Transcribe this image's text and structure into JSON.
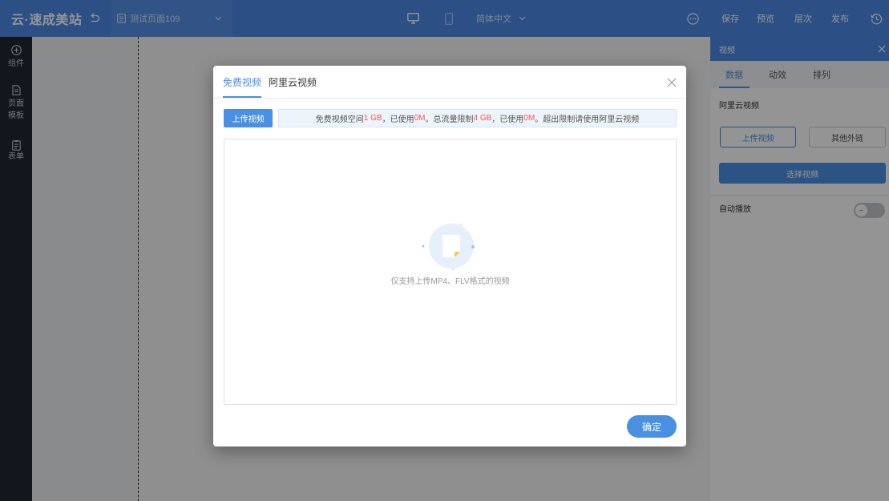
{
  "app": {
    "logo": "云·速成美站",
    "page_name": "测试页面109",
    "language": "简体中文",
    "desktop_view_active": true,
    "mobile_view_active": false,
    "actions": {
      "save": "保存",
      "preview": "预览",
      "layers": "层次",
      "publish": "发布"
    }
  },
  "sidebar": {
    "items": [
      {
        "label": "组件",
        "icon": "plus-circle-icon"
      },
      {
        "label": "页面模板",
        "icon": "page-template-icon"
      },
      {
        "label": "表单",
        "icon": "form-icon"
      }
    ]
  },
  "properties_panel": {
    "title": "视频",
    "tabs": [
      {
        "label": "数据",
        "active": true
      },
      {
        "label": "动效",
        "active": false
      },
      {
        "label": "排列",
        "active": false
      }
    ],
    "section_title": "阿里云视频",
    "upload_button": "上传视频",
    "external_link_button": "其他外链",
    "select_video_button": "选择视频",
    "autoplay_label": "自动播放",
    "autoplay_enabled": false
  },
  "video_modal": {
    "tabs": [
      {
        "label": "免费视频",
        "active": true
      },
      {
        "label": "阿里云视频",
        "active": false
      }
    ],
    "upload_button": "上传视频",
    "quota_segments": [
      {
        "text": "免费视频空间",
        "highlight": false
      },
      {
        "text": "1 GB",
        "highlight": true
      },
      {
        "text": "，已使用",
        "highlight": false
      },
      {
        "text": "0M",
        "highlight": true
      },
      {
        "text": "。总流量限制",
        "highlight": false
      },
      {
        "text": "4 GB",
        "highlight": true
      },
      {
        "text": "，已使用",
        "highlight": false
      },
      {
        "text": "0M",
        "highlight": true
      },
      {
        "text": "。超出限制请使用阿里云视频",
        "highlight": false
      }
    ],
    "empty_hint": "仅支持上传MP4、FLV格式的视频",
    "confirm_button": "确定"
  },
  "colors": {
    "topbar": "#4d8ae6",
    "accent": "#4a90e2",
    "quota_highlight": "#f5584a",
    "overlay": "rgba(0,0,0,0.42)"
  }
}
